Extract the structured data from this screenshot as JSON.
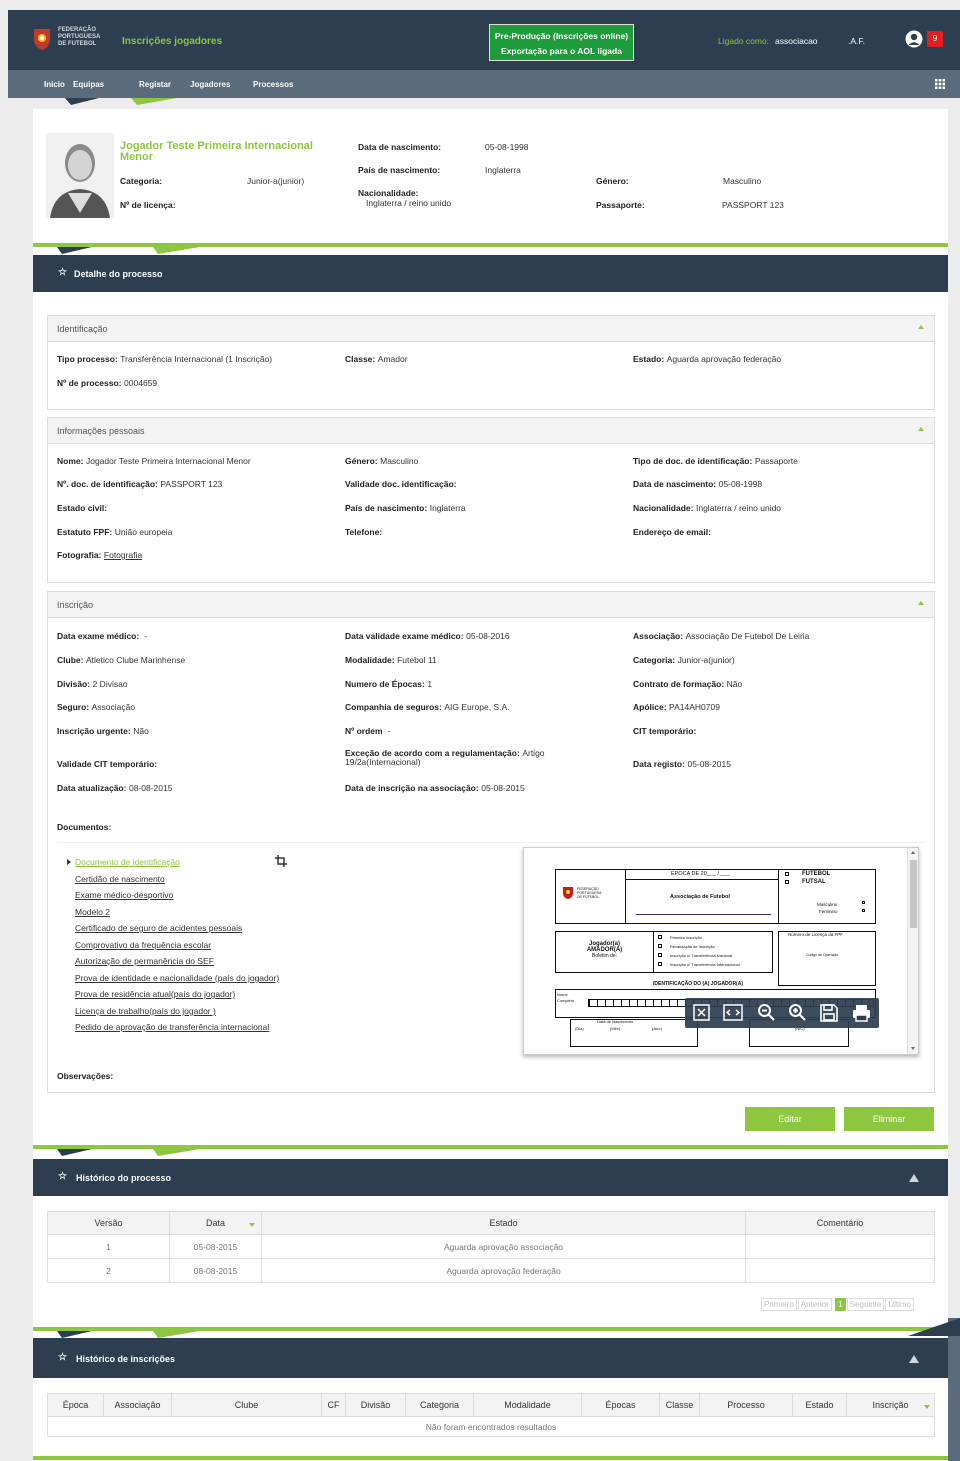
{
  "header": {
    "org_line1": "FEDERAÇÃO",
    "org_line2": "PORTUGUESA",
    "org_line3": "DE FUTEBOL",
    "app_title": "Inscrições jogadores",
    "env_line1": "Pre-Produção (Inscrições online)",
    "env_line2": "Exportação para o AOL ligada",
    "logged_label": "Ligado como:",
    "logged_user": "associacao",
    "user_short": ".A.F.",
    "notif_count": "9"
  },
  "nav": {
    "items": [
      "Inicio",
      "Equipas",
      "Registar",
      "Jogadores",
      "Processos"
    ]
  },
  "player": {
    "name": "Jogador Teste Primeira Internacional Menor",
    "categoria_label": "Categoria:",
    "categoria": "Junior-a(junior)",
    "licenca_label": "Nº de licença:",
    "nasc_label": "Data de nascimento:",
    "nasc": "05-08-1998",
    "pais_label": "País de nascimento:",
    "pais": "Inglaterra",
    "nac_label": "Nacionalidade:",
    "nac": "Inglaterra / reino unido",
    "genero_label": "Género:",
    "genero": "Masculino",
    "passaporte_label": "Passaporte:",
    "passaporte": "PASSPORT 123"
  },
  "detalhe": {
    "title": "Detalhe do processo",
    "ident": {
      "title": "Identificação",
      "tipo_label": "Tipo processo:",
      "tipo": "Transferência Internacional (1 Inscrição)",
      "classe_label": "Classe:",
      "classe": "Amador",
      "estado_label": "Estado:",
      "estado": "Aguarda aprovação federação",
      "num_label": "Nº de processo:",
      "num": "0004659"
    },
    "pessoais": {
      "title": "Informações pessoais",
      "nome_label": "Nome:",
      "nome": "Jogador Teste Primeira Internacional Menor",
      "genero_label": "Género:",
      "genero": "Masculino",
      "tipodoc_label": "Tipo de doc. de identificação:",
      "tipodoc": "Passaporte",
      "numdoc_label": "Nº. doc. de identificação:",
      "numdoc": "PASSPORT 123",
      "validade_label": "Validade doc. identificação:",
      "datanasc_label": "Data de nascimento:",
      "datanasc": "05-08-1998",
      "civil_label": "Estado civil:",
      "paisnasc_label": "País de nascimento:",
      "paisnasc": "Inglaterra",
      "nac_label": "Nacionalidade:",
      "nac": "Inglaterra / reino unido",
      "estatuto_label": "Estatuto FPF:",
      "estatuto": "União europeia",
      "tel_label": "Telefone:",
      "email_label": "Endereço de email:",
      "foto_label": "Fotografia:",
      "foto_link": "Fotografia"
    },
    "inscricao": {
      "title": "Inscrição",
      "exame_label": "Data exame médico:",
      "exame": "-",
      "valexame_label": "Data validade exame médico:",
      "valexame": "05-08-2016",
      "assoc_label": "Associação:",
      "assoc": "Associação De Futebol De Leiria",
      "clube_label": "Clube:",
      "clube": "Atletico Clube Marinhense",
      "modal_label": "Modalidade:",
      "modal": "Futebol 11",
      "cat_label": "Categoria:",
      "cat": "Junior-a(junior)",
      "div_label": "Divisão:",
      "div": "2 Divisao",
      "epocas_label": "Numero de Épocas:",
      "epocas": "1",
      "contrato_label": "Contrato de formação:",
      "contrato": "Não",
      "seguro_label": "Seguro:",
      "seguro": "Associação",
      "comp_label": "Companhia de seguros:",
      "comp": "AIG Europe, S.A.",
      "apolice_label": "Apólice:",
      "apolice": "PA14AH0709",
      "urgente_label": "Inscrição urgente:",
      "urgente": "Não",
      "ordem_label": "Nº ordem",
      "ordem": "-",
      "cit_label": "CIT temporário:",
      "valcit_label": "Validade CIT temporário:",
      "excecao_label": "Exceção de acordo com a regulamentação:",
      "excecao1": "Artigo",
      "excecao2": "19/2a(Internacional)",
      "registo_label": "Data registo:",
      "registo": "05-08-2015",
      "atual_label": "Data atualização:",
      "atual": "08-08-2015",
      "datainsc_label": "Data de inscrição na associação:",
      "datainsc": "05-08-2015",
      "docs_label": "Documentos:",
      "obs_label": "Observações:",
      "docs": [
        "Documento de identificação",
        "Certidão de nascimento",
        "Exame médico-desportivo",
        "Modelo 2",
        "Certificado de seguro de acidentes pessoais",
        "Comprovativo da frequência escolar",
        "Autorização de permanência do SEF",
        "Prova de identidade e nacionalidade (país do jogador)",
        "Prova de residência atual(país do jogador)",
        "Licença de trabalho(país do jogador )",
        "Pedido de aprovação de transferência internacional"
      ]
    },
    "form_preview": {
      "epoca": "ÉPOCA DE 20___ / ___",
      "futebol": "FUTEBOL",
      "futsal": "FUTSAL",
      "fed1": "FEDERAÇÃO",
      "fed2": "PORTUGUESA",
      "fed3": "DE FUTEBOL",
      "assoc": "Associação de Futebol",
      "masc": "Masculino",
      "fem": "Feminino",
      "jog1": "Jogador(a)",
      "jog2": "AMADOR(A)",
      "jog3": "Boletim de:",
      "opt1": "Primeira Inscrição",
      "opt2": "Revalidação de Inscrição",
      "opt3": "Inscrição c/ Transferência Nacional",
      "opt4": "Inscrição c/ Transferência Internacional",
      "numlic": "Número de Licença da FPF",
      "codop": "Código de Operação",
      "ident": "IDENTIFICAÇÃO DO (A) JOGADOR(A)",
      "nome": "Nome",
      "completo": "Completo",
      "datanasc": "Data de Nascimento",
      "dia": "(Dia)",
      "mes": "(Mês)",
      "ano": "(Ano)",
      "nic": "(NIC)"
    },
    "edit_label": "Editar",
    "delete_label": "Eliminar"
  },
  "historico": {
    "title": "Histórico do processo",
    "columns": [
      "Versão",
      "Data",
      "Estado",
      "Comentário"
    ],
    "rows": [
      [
        "1",
        "05-08-2015",
        "Aguarda aprovação associação",
        ""
      ],
      [
        "2",
        "08-08-2015",
        "Aguarda aprovação federação",
        ""
      ]
    ],
    "pager": [
      "Primeiro",
      "Anterior",
      "1",
      "Seguinte",
      "Último"
    ]
  },
  "insc_hist": {
    "title": "Histórico de inscrições",
    "columns": [
      "Época",
      "Associação",
      "Clube",
      "CF",
      "Divisão",
      "Categoria",
      "Modalidade",
      "Épocas",
      "Classe",
      "Processo",
      "Estado",
      "Inscrição"
    ],
    "empty": "Não foram encontrados resultados"
  },
  "colors": {
    "accent": "#8dc63f",
    "dark": "#2c3e50"
  }
}
